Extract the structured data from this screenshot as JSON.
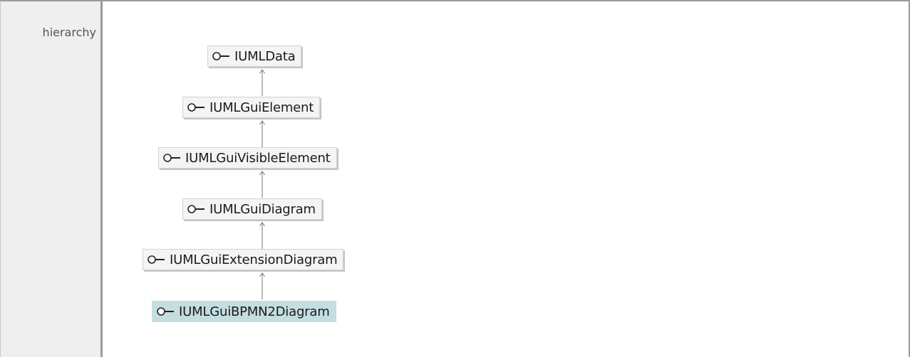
{
  "section_label": "hierarchy",
  "hierarchy": {
    "nodes": [
      {
        "name": "IUMLData",
        "icon": "interface-icon",
        "current": false
      },
      {
        "name": "IUMLGuiElement",
        "icon": "interface-icon",
        "current": false
      },
      {
        "name": "IUMLGuiVisibleElement",
        "icon": "interface-icon",
        "current": false
      },
      {
        "name": "IUMLGuiDiagram",
        "icon": "interface-icon",
        "current": false
      },
      {
        "name": "IUMLGuiExtensionDiagram",
        "icon": "interface-icon",
        "current": false
      },
      {
        "name": "IUMLGuiBPMN2Diagram",
        "icon": "interface-icon",
        "current": true
      }
    ]
  },
  "colors": {
    "node_background": "#f4f4f4",
    "current_node_background": "#c3dde0",
    "label_column_background": "#efefef",
    "border": "#9b9b9b"
  }
}
